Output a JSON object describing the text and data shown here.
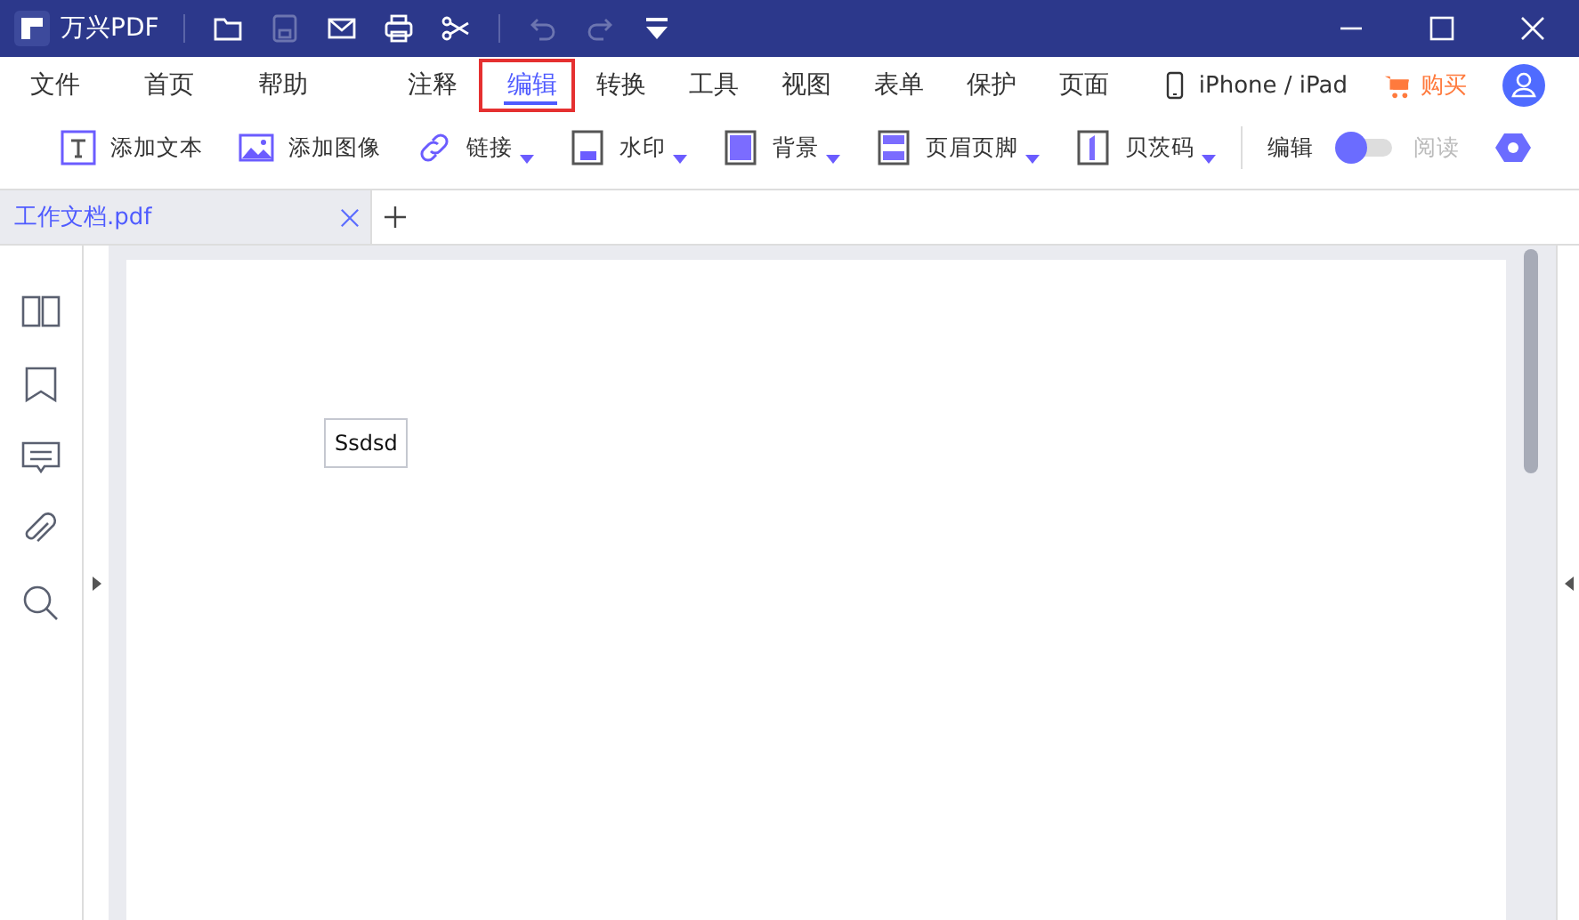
{
  "window": {
    "title": "万兴PDF",
    "quick_tools": [
      {
        "kind": "open",
        "disabled": false
      },
      {
        "kind": "save",
        "disabled": true
      },
      {
        "kind": "mail",
        "disabled": false
      },
      {
        "kind": "print",
        "disabled": false
      },
      {
        "kind": "share",
        "disabled": false
      },
      {
        "kind": "undo",
        "disabled": true
      },
      {
        "kind": "redo",
        "disabled": true
      },
      {
        "kind": "more"
      }
    ]
  },
  "menu": [
    {
      "label": "文件",
      "selected": false
    },
    {
      "label": "首页",
      "selected": false
    },
    {
      "label": "帮助",
      "selected": false
    },
    {
      "label": "注释",
      "selected": false
    },
    {
      "label": "编辑",
      "selected": true
    },
    {
      "label": "转换",
      "selected": false
    },
    {
      "label": "工具",
      "selected": false
    },
    {
      "label": "视图",
      "selected": false
    },
    {
      "label": "表单",
      "selected": false
    },
    {
      "label": "保护",
      "selected": false
    },
    {
      "label": "页面",
      "selected": false
    }
  ],
  "device_link": "iPhone / iPad",
  "buy": "购买",
  "toolbar": [
    {
      "kind": "text",
      "label": "添加文本",
      "dropdown": false
    },
    {
      "kind": "image",
      "label": "添加图像",
      "dropdown": false
    },
    {
      "kind": "link",
      "label": "链接",
      "dropdown": true
    },
    {
      "kind": "watermark",
      "label": "水印",
      "dropdown": true
    },
    {
      "kind": "background",
      "label": "背景",
      "dropdown": true
    },
    {
      "kind": "header",
      "label": "页眉页脚",
      "dropdown": true
    },
    {
      "kind": "bates",
      "label": "贝茨码",
      "dropdown": true
    }
  ],
  "mode_toggle": [
    {
      "label": "编辑",
      "selected": true
    },
    {
      "label": "阅读",
      "selected": false
    }
  ],
  "tabs": [
    {
      "label": "工作文档.pdf",
      "selected": true
    }
  ],
  "sidebar": [
    {
      "kind": "thumbnails"
    },
    {
      "kind": "bookmark"
    },
    {
      "kind": "comment"
    },
    {
      "kind": "attachment"
    },
    {
      "kind": "search"
    }
  ],
  "page": {
    "text_box": "Ssdsd"
  }
}
